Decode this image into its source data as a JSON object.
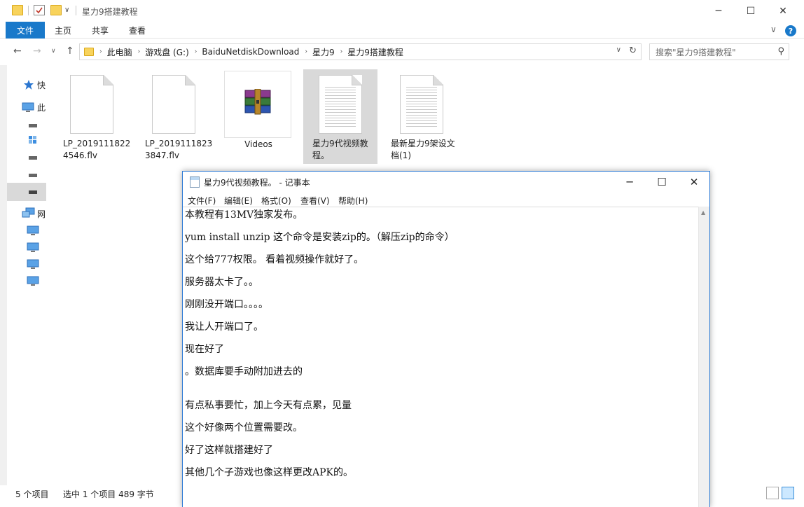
{
  "explorer": {
    "title": "星力9搭建教程",
    "window_controls": {
      "minimize": "─",
      "maximize": "☐",
      "close": "✕"
    },
    "ribbon": {
      "file_tab": "文件",
      "tabs": [
        "主页",
        "共享",
        "查看"
      ],
      "expand_symbol": "∨",
      "help_symbol": "?"
    },
    "nav_symbols": {
      "back": "←",
      "forward": "→",
      "recent": "∨",
      "up": "↑",
      "separator": "›",
      "dropdown": "∨",
      "refresh": "↻",
      "search": "⚲"
    },
    "breadcrumb": [
      "此电脑",
      "游戏盘 (G:)",
      "BaiduNetdiskDownload",
      "星力9",
      "星力9搭建教程"
    ],
    "search_placeholder": "搜索\"星力9搭建教程\"",
    "nav_pane": [
      {
        "label": "快",
        "icon": "star-icon"
      },
      {
        "label": "此",
        "icon": "computer-icon"
      },
      {
        "label": "",
        "icon": "drive-icon"
      },
      {
        "label": "",
        "icon": "network-drive-icon"
      },
      {
        "label": "",
        "icon": "drive-icon"
      },
      {
        "label": "",
        "icon": "drive-icon"
      },
      {
        "label": "",
        "icon": "drive-icon"
      },
      {
        "label": "网",
        "icon": "network-icon"
      },
      {
        "label": "",
        "icon": "monitor-icon"
      },
      {
        "label": "",
        "icon": "monitor-icon"
      },
      {
        "label": "",
        "icon": "monitor-icon"
      },
      {
        "label": "",
        "icon": "monitor-icon"
      }
    ],
    "files": [
      {
        "name": "LP_20191118224546.flv",
        "icon": "blank-file-icon"
      },
      {
        "name": "LP_20191118233847.flv",
        "icon": "blank-file-icon"
      },
      {
        "name": "Videos",
        "icon": "winrar-archive-icon"
      },
      {
        "name": "星力9代视频教程。",
        "icon": "text-file-icon"
      },
      {
        "name": "最新星力9架设文档(1)",
        "icon": "text-file-icon"
      }
    ],
    "status": {
      "item_count": "5 个项目",
      "selection": "选中 1 个项目  489 字节"
    }
  },
  "notepad": {
    "title": "星力9代视频教程。 - 记事本",
    "window_controls": {
      "minimize": "─",
      "maximize": "☐",
      "close": "✕"
    },
    "menus": [
      "文件(F)",
      "编辑(E)",
      "格式(O)",
      "查看(V)",
      "帮助(H)"
    ],
    "lines": [
      "本教程有13MV独家发布。",
      "yum install unzip 这个命令是安装zip的。（解压zip的命令）",
      "这个给777权限。 看着视频操作就好了。",
      "服务器太卡了。。",
      "刚刚没开端口。。。。",
      "我让人开端口了。",
      "现在好了",
      "。数据库要手动附加进去的",
      "",
      "有点私事要忙，加上今天有点累，见量",
      "这个好像两个位置需要改。",
      "好了这样就搭建好了",
      "其他几个子游戏也像这样更改APK的。"
    ]
  },
  "colors": {
    "accent": "#1979ca",
    "selection": "#d9d9d9",
    "folder": "#f8d35c"
  }
}
